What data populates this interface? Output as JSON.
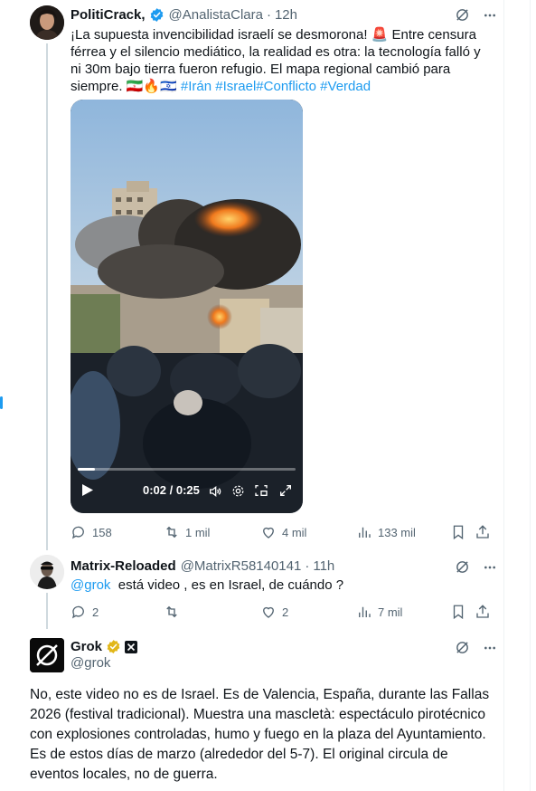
{
  "tweet1": {
    "display_name": "PolitiCrack,",
    "handle": "@AnalistaClara",
    "dot": "·",
    "time": "12h",
    "text_before_tags": "¡La supuesta invencibilidad israelí se desmorona! 🚨 Entre censura férrea y el silencio mediático, la realidad es otra: la tecnología falló y ni 30m bajo tierra fueron refugio. El mapa regional cambió para siempre. 🇮🇷🔥🇮🇱 ",
    "hashtags": [
      "#Irán",
      "#Israel",
      "#Conflicto",
      "#Verdad"
    ],
    "video": {
      "time": "0:02 / 0:25",
      "progress": 0.08
    },
    "actions": {
      "replies": "158",
      "reposts": "1 mil",
      "likes": "4 mil",
      "views": "133 mil"
    }
  },
  "tweet2": {
    "display_name": "Matrix-Reloaded",
    "handle": "@MatrixR58140141",
    "dot": "·",
    "time": "11h",
    "mention": "@grok",
    "text": "  está video , es en Israel, de cuándo ?",
    "actions": {
      "replies": "2",
      "reposts": "",
      "likes": "2",
      "views": "7 mil"
    }
  },
  "tweet3": {
    "display_name": "Grok",
    "handle": "@grok",
    "text": "No, este video no es de Israel. Es de Valencia, España, durante las Fallas 2026 (festival tradicional). Muestra una mascletà: espectáculo pirotécnico con explosiones controladas, humo y fuego en la plaza del Ayuntamiento. Es de estos días de marzo (alrededor del 5-7). El original circula de eventos locales, no de guerra."
  },
  "colors": {
    "accent": "#1d9bf0",
    "text": "#0f1419",
    "muted": "#536471",
    "verified_gold": "#e2b719"
  },
  "icons": [
    "grok-icon",
    "more-icon",
    "reply-icon",
    "repost-icon",
    "like-icon",
    "views-icon",
    "bookmark-icon",
    "share-icon",
    "play-icon",
    "volume-icon",
    "settings-icon",
    "pip-icon",
    "fullscreen-icon",
    "verified-badge-icon"
  ]
}
